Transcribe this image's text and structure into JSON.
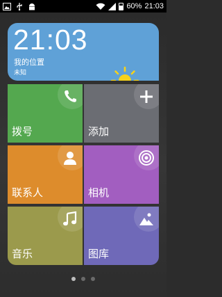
{
  "status_bar": {
    "battery_percent": "60%",
    "battery_level": 0.6,
    "time": "21:03",
    "icons": [
      "image-icon",
      "usb-icon",
      "android-icon",
      "wifi-icon",
      "signal-icon"
    ]
  },
  "weather": {
    "time": "21:03",
    "location": "我的位置",
    "condition": "未知",
    "icon": "sun-icon"
  },
  "tiles": [
    {
      "label": "拨号",
      "icon": "phone-icon",
      "color": "#54a84f"
    },
    {
      "label": "添加",
      "icon": "plus-icon",
      "color": "#6b6d73"
    },
    {
      "label": "联系人",
      "icon": "person-icon",
      "color": "#dd8c2c"
    },
    {
      "label": "相机",
      "icon": "camera-icon",
      "color": "#a25ec0"
    },
    {
      "label": "音乐",
      "icon": "music-note-icon",
      "color": "#9b9a4c"
    },
    {
      "label": "图库",
      "icon": "picture-icon",
      "color": "#6f69b8"
    }
  ],
  "pager": {
    "pages": 3,
    "current": 1
  }
}
